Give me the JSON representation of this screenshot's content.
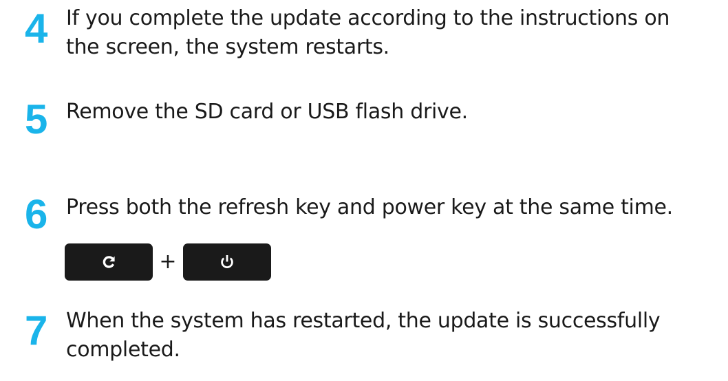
{
  "colors": {
    "step_number": "#1ab4ea",
    "text": "#1a1a1a",
    "key_background": "#1a1a1a",
    "key_icon": "#ffffff"
  },
  "steps": [
    {
      "number": "4",
      "text": "If you complete the update according to the instructions on\nthe screen, the system restarts."
    },
    {
      "number": "5",
      "text": "Remove the SD card or USB flash drive."
    },
    {
      "number": "6",
      "text": "Press both the refresh key and power key at the same time."
    },
    {
      "number": "7",
      "text": "When the system has restarted, the update is successfully\ncompleted."
    }
  ],
  "key_combo": {
    "keys": [
      {
        "icon": "refresh-icon"
      },
      {
        "icon": "power-icon"
      }
    ],
    "separator": "+"
  }
}
